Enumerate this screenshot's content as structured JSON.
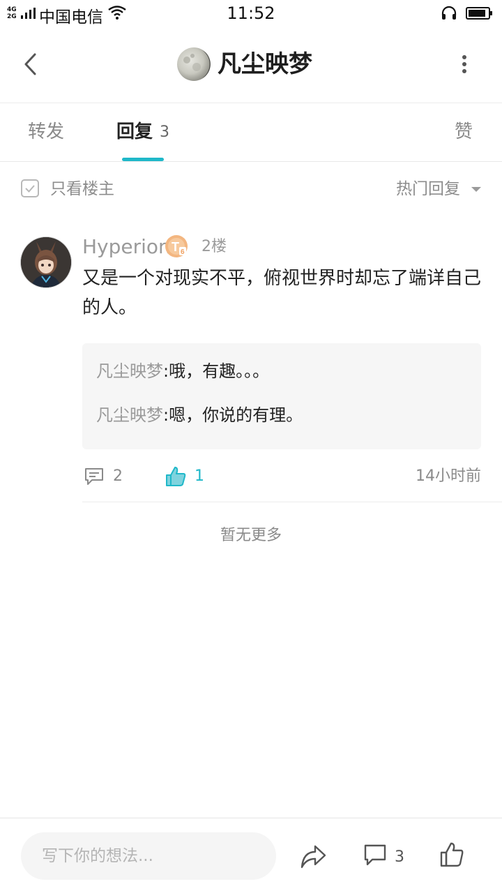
{
  "status_bar": {
    "network_top": "4G",
    "network_bottom": "2G",
    "carrier": "中国电信",
    "time": "11:52"
  },
  "header": {
    "title": "凡尘映梦"
  },
  "tabs": {
    "forward": "转发",
    "reply": "回复",
    "reply_count": "3",
    "like": "赞"
  },
  "filter": {
    "only_op": "只看楼主",
    "sort": "热门回复"
  },
  "comment": {
    "username": "Hyperion",
    "badge_letter": "T",
    "badge_level": "6",
    "floor": "2楼",
    "text": "又是一个对现实不平，俯视世界时却忘了端详自己的人。",
    "replies": [
      {
        "author": "凡尘映梦",
        "separator": ":",
        "text": "哦，有趣。。。"
      },
      {
        "author": "凡尘映梦",
        "separator": ":",
        "text": "嗯，你说的有理。"
      }
    ],
    "reply_count": "2",
    "like_count": "1",
    "time_ago": "14小时前"
  },
  "no_more": "暂无更多",
  "bottom_bar": {
    "input_placeholder": "写下你的想法...",
    "comments_count": "3"
  },
  "colors": {
    "accent": "#1fb8c9",
    "muted_text": "#9a9a9a",
    "badge": "#f0b27a"
  }
}
